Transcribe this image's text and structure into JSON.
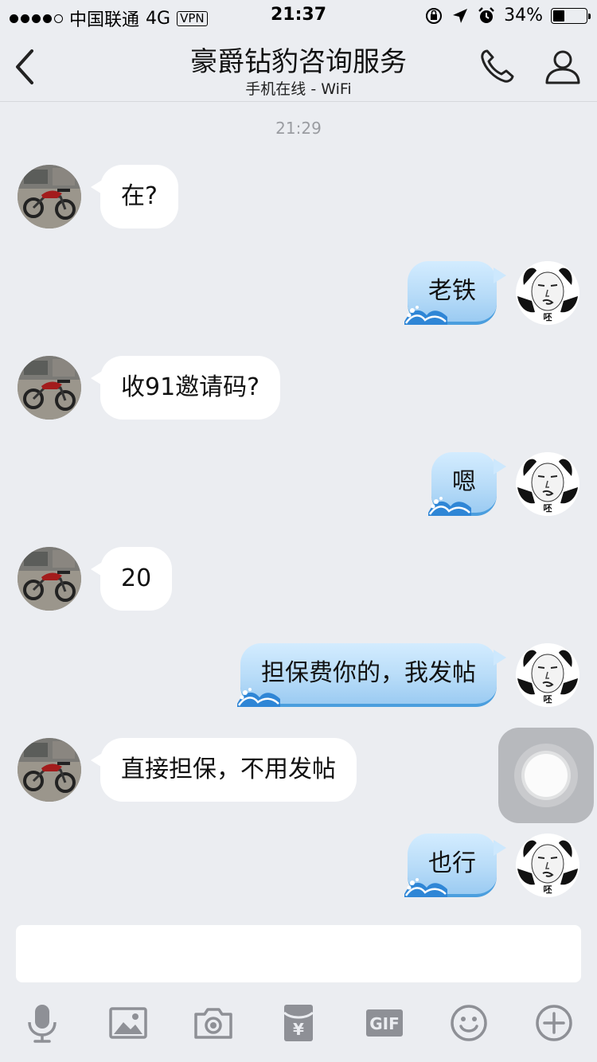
{
  "status_bar": {
    "carrier": "中国联通",
    "network": "4G",
    "vpn": "VPN",
    "time": "21:37",
    "battery_percent": "34%",
    "battery_level": 0.34
  },
  "header": {
    "title": "豪爵钻豹咨询服务",
    "subtitle": "手机在线 - WiFi"
  },
  "timestamp": "21:29",
  "messages": [
    {
      "side": "in",
      "text": "在?"
    },
    {
      "side": "out",
      "text": "老铁"
    },
    {
      "side": "in",
      "text": "收91邀请码?"
    },
    {
      "side": "out",
      "text": "嗯"
    },
    {
      "side": "in",
      "text": "20"
    },
    {
      "side": "out",
      "text": "担保费你的，我发帖"
    },
    {
      "side": "in",
      "text": "直接担保，不用发帖"
    },
    {
      "side": "out",
      "text": "也行"
    }
  ],
  "avatar_out_caption": "呸",
  "input": {
    "placeholder": "",
    "value": ""
  },
  "toolbar": {
    "icons": [
      "microphone-icon",
      "image-icon",
      "camera-icon",
      "red-packet-icon",
      "gif-icon",
      "emoji-icon",
      "plus-icon"
    ],
    "gif_label": "GIF"
  },
  "colors": {
    "background": "#ebedf1",
    "bubble_in": "#ffffff",
    "bubble_out": "#b8dcf8",
    "bubble_out_border": "#4b9ede",
    "icon_gray": "#8e9096"
  }
}
